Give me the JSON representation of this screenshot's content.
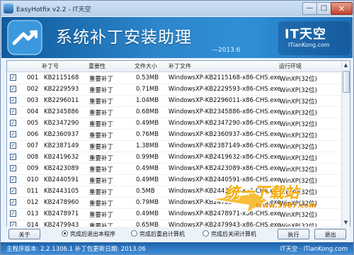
{
  "window": {
    "title": "EasyHotfix v2.2 - IT天空"
  },
  "banner": {
    "title": "系统补丁安装助理",
    "date": "—2013.6",
    "brand_main": "IT天空",
    "brand_sub": "ITianKong.com"
  },
  "table": {
    "headers": [
      "补丁号",
      "重要性",
      "文件大小",
      "补丁文件",
      "运行环境"
    ],
    "rows": [
      {
        "index": "001",
        "kb": "KB2115168",
        "importance": "重要补丁",
        "size": "0.53MB",
        "file": "WindowsXP-KB2115168-x86-CHS.exe",
        "env": "WinXP(32位)"
      },
      {
        "index": "002",
        "kb": "KB2229593",
        "importance": "重要补丁",
        "size": "0.71MB",
        "file": "WindowsXP-KB2229593-x86-CHS.exe",
        "env": "WinXP(32位)"
      },
      {
        "index": "003",
        "kb": "KB2296011",
        "importance": "重要补丁",
        "size": "1.04MB",
        "file": "WindowsXP-KB2296011-x86-CHS.exe",
        "env": "WinXP(32位)"
      },
      {
        "index": "004",
        "kb": "KB2345886",
        "importance": "重要补丁",
        "size": "0.68MB",
        "file": "WindowsXP-KB2345886-x86-CHS.exe",
        "env": "WinXP(32位)"
      },
      {
        "index": "005",
        "kb": "KB2347290",
        "importance": "重要补丁",
        "size": "0.49MB",
        "file": "WindowsXP-KB2347290-x86-CHS.exe",
        "env": "WinXP(32位)"
      },
      {
        "index": "006",
        "kb": "KB2360937",
        "importance": "重要补丁",
        "size": "0.76MB",
        "file": "WindowsXP-KB2360937-x86-CHS.exe",
        "env": "WinXP(32位)"
      },
      {
        "index": "007",
        "kb": "KB2387149",
        "importance": "重要补丁",
        "size": "1.38MB",
        "file": "WindowsXP-KB2387149-x86-CHS.exe",
        "env": "WinXP(32位)"
      },
      {
        "index": "008",
        "kb": "KB2419632",
        "importance": "重要补丁",
        "size": "0.99MB",
        "file": "WindowsXP-KB2419632-x86-CHS.exe",
        "env": "WinXP(32位)"
      },
      {
        "index": "009",
        "kb": "KB2423089",
        "importance": "重要补丁",
        "size": "0.49MB",
        "file": "WindowsXP-KB2423089-x86-CHS.exe",
        "env": "WinXP(32位)"
      },
      {
        "index": "010",
        "kb": "KB2440591",
        "importance": "重要补丁",
        "size": "0.49MB",
        "file": "WindowsXP-KB2440591-x86-CHS.exe",
        "env": "WinXP(32位)"
      },
      {
        "index": "011",
        "kb": "KB2443105",
        "importance": "重要补丁",
        "size": "0.5MB",
        "file": "WindowsXP-KB2443105-x86-CHS.exe",
        "env": "WinXP(32位)"
      },
      {
        "index": "012",
        "kb": "KB2478960",
        "importance": "重要补丁",
        "size": "0.79MB",
        "file": "WindowsXP-KB2478960-x86-CHS.exe",
        "env": "WinXP(32位)"
      },
      {
        "index": "013",
        "kb": "KB2478971",
        "importance": "重要补丁",
        "size": "0.49MB",
        "file": "WindowsXP-KB2478971-x86-CHS.exe",
        "env": "WinXP(32位)"
      },
      {
        "index": "014",
        "kb": "KB2479943",
        "importance": "重要补丁",
        "size": "0.65MB",
        "file": "WindowsXP-KB2479943-x86-CHS.exe",
        "env": "WinXP(32位)"
      }
    ]
  },
  "watermark": {
    "text": "统一下载站",
    "url": "www.3987.com"
  },
  "controls": {
    "about_label": "关于",
    "radio_1": "完成后退出本程序",
    "radio_2": "完成后重启计算机",
    "radio_3": "完成后关闭计算机",
    "execute_label": "执行",
    "exit_label": "退出",
    "selected_radio": "完成后退出本程序"
  },
  "status": {
    "left": "主程序版本: 2.2.1306.1  补丁包更新日期: 2013.06",
    "right": "IT天空 · ITianKong.com"
  },
  "colors": {
    "banner_blue": "#2e86cb",
    "status_blue": "#2f78c5",
    "checkbox_blue": "#1d4f86",
    "watermark_orange": "#f5ab00"
  }
}
